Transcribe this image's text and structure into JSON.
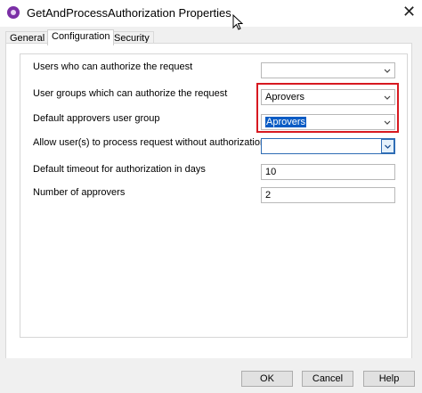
{
  "window": {
    "title": "GetAndProcessAuthorization Properties",
    "close_label": "✕"
  },
  "tabs": [
    {
      "label": "General",
      "active": false
    },
    {
      "label": "Configuration",
      "active": true
    },
    {
      "label": "Security",
      "active": false
    }
  ],
  "form": {
    "users_who_can_authorize": {
      "label": "Users who can authorize the request",
      "value": ""
    },
    "user_groups": {
      "label": "User groups which can authorize the request",
      "value": "Aprovers"
    },
    "default_group": {
      "label": "Default approvers user group",
      "value": "Aprovers"
    },
    "allow_without_auth": {
      "label": "Allow user(s) to process request without authorization",
      "value": ""
    },
    "default_timeout": {
      "label": "Default timeout for authorization in days",
      "value": "10"
    },
    "number_of_approvers": {
      "label": "Number of approvers",
      "value": "2"
    }
  },
  "buttons": {
    "ok": "OK",
    "cancel": "Cancel",
    "help": "Help"
  },
  "colors": {
    "highlight": "#d71920",
    "selection": "#0a5bc4"
  }
}
